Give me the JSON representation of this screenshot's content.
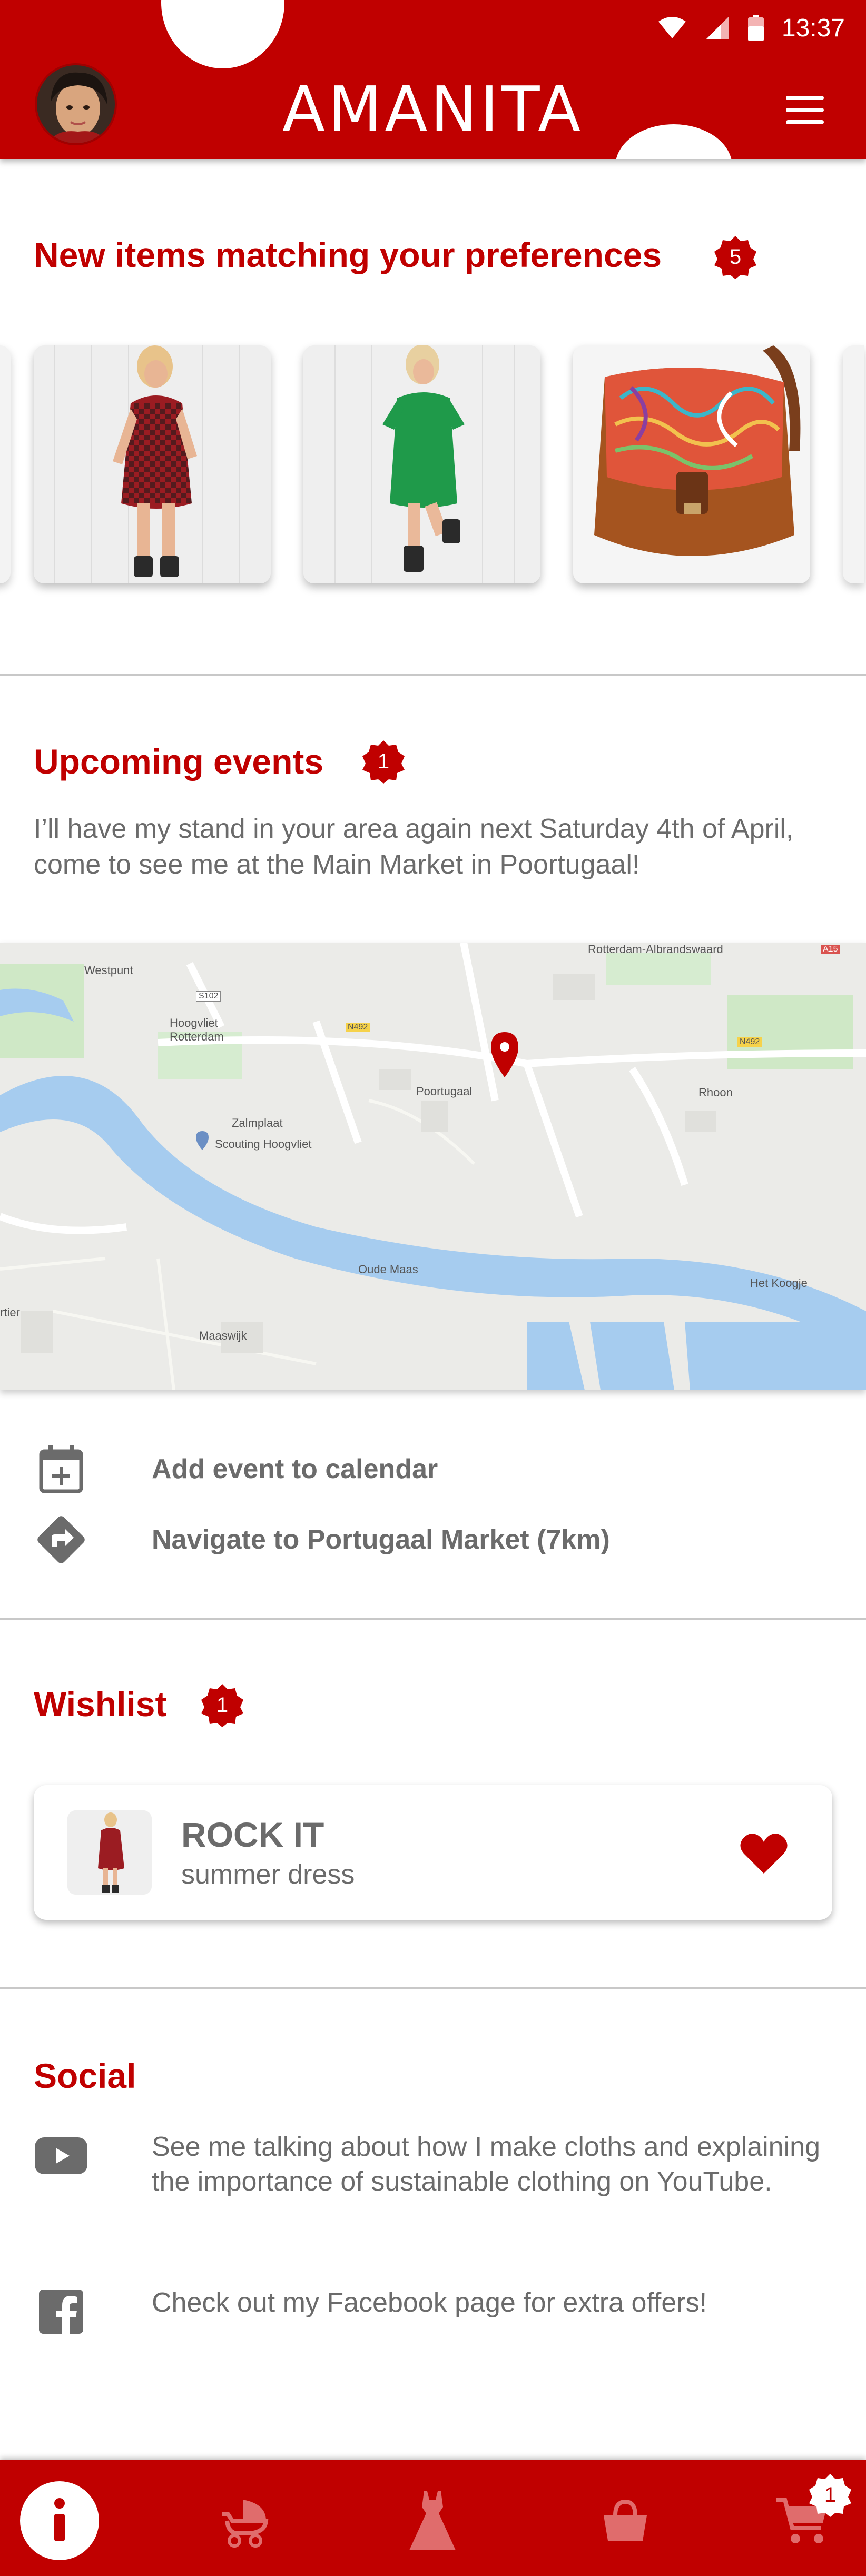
{
  "status": {
    "time": "13:37"
  },
  "header": {
    "title": "AMANITA"
  },
  "preferences": {
    "title": "New items matching your preferences",
    "badge": "5",
    "items": [
      {
        "name": "red-checkered-dress"
      },
      {
        "name": "green-dress"
      },
      {
        "name": "patterned-bag"
      }
    ]
  },
  "events": {
    "title": "Upcoming events",
    "badge": "1",
    "text": "I’ll have my stand in your area again next Saturday 4th of April, come to see me at the Main Market in Poortugaal!",
    "map_labels": {
      "westpunt": "Westpunt",
      "hoogvliet": "Hoogvliet Rotterdam",
      "zalmplaat": "Zalmplaat",
      "scouting": "Scouting Hoogvliet",
      "poortugaal": "Poortugaal",
      "rhoon": "Rhoon",
      "oude_maas": "Oude Maas",
      "maaswijk": "Maaswijk",
      "top": "Rotterdam-Albrandswaard",
      "n492": "N492",
      "a15": "A15",
      "s102": "S102",
      "het_koogje": "Het Koogje",
      "rtier": "rtier"
    },
    "actions": [
      {
        "label": "Add event to calendar",
        "icon": "calendar-plus-icon"
      },
      {
        "label": "Navigate to Portugaal Market (7km)",
        "icon": "directions-icon"
      }
    ]
  },
  "wishlist": {
    "title": "Wishlist",
    "badge": "1",
    "item": {
      "name": "ROCK IT",
      "subtitle": "summer dress"
    }
  },
  "social": {
    "title": "Social",
    "rows": [
      {
        "icon": "youtube-icon",
        "text": "See me talking about how I make cloths and explaining the importance of sustainable clothing on YouTube."
      },
      {
        "icon": "facebook-icon",
        "text": "Check out my Facebook page for extra offers!"
      }
    ]
  },
  "bottom_nav": {
    "items": [
      "info-icon",
      "stroller-icon",
      "dress-icon",
      "bag-icon",
      "cart-icon"
    ],
    "cart_badge": "1"
  },
  "colors": {
    "brand": "#c00000",
    "text": "#6b6b6b",
    "divider": "#c8c8c8"
  }
}
